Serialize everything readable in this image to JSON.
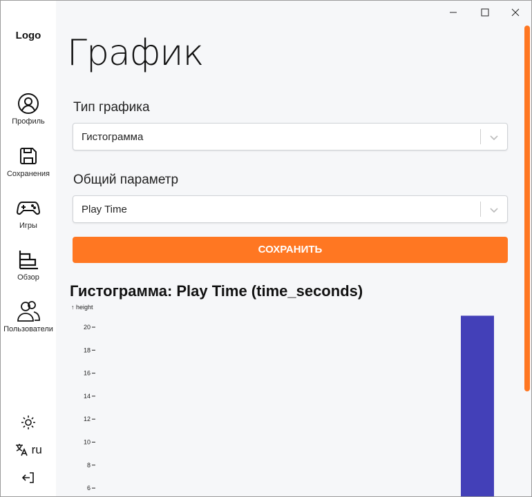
{
  "sidebar": {
    "logo": "Logo",
    "items": [
      {
        "label": "Профиль",
        "icon": "user-circle-icon"
      },
      {
        "label": "Сохранения",
        "icon": "save-icon"
      },
      {
        "label": "Игры",
        "icon": "gamepad-icon"
      },
      {
        "label": "Обзор",
        "icon": "chart-icon"
      },
      {
        "label": "Пользователи",
        "icon": "users-icon"
      }
    ],
    "theme_icon": "sun-icon",
    "language": "ru",
    "logout_icon": "logout-icon"
  },
  "main": {
    "title": "График",
    "chart_type_label": "Тип графика",
    "chart_type_value": "Гистограмма",
    "parameter_label": "Общий параметр",
    "parameter_value": "Play Time",
    "save_label": "СОХРАНИТЬ"
  },
  "colors": {
    "accent": "#ff7722",
    "bar": "#4340b8"
  },
  "chart_data": {
    "type": "bar",
    "title": "Гистограмма: Play Time (time_seconds)",
    "ylabel": "↑ height",
    "yticks": [
      20,
      18,
      16,
      14,
      12,
      10,
      8,
      6
    ],
    "ylim": [
      6,
      21
    ],
    "values": [
      0,
      0,
      0,
      0,
      0,
      0,
      0,
      0,
      0,
      0,
      0,
      21
    ]
  }
}
